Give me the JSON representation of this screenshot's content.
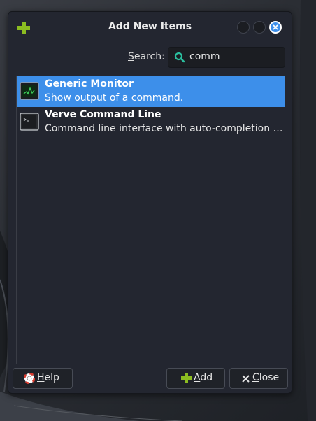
{
  "dialog": {
    "title": "Add New Items",
    "search": {
      "label_first": "S",
      "label_rest": "earch:",
      "value": "comm"
    },
    "items": [
      {
        "name": "Generic Monitor",
        "description": "Show output of a command.",
        "selected": true
      },
      {
        "name": "Verve Command Line",
        "description": "Command line interface with auto-completion and...",
        "selected": false
      }
    ],
    "buttons": {
      "help": {
        "mnemonic": "H",
        "rest": "elp"
      },
      "add": {
        "mnemonic": "A",
        "rest": "dd"
      },
      "close": {
        "mnemonic": "C",
        "rest": "lose"
      }
    }
  },
  "colors": {
    "selection": "#3d8fea",
    "add_icon": "#8bbc21",
    "background": "#232630"
  },
  "icons": [
    "add-icon",
    "window-min-icon",
    "window-max-icon",
    "close-icon",
    "search-icon",
    "monitor-icon",
    "terminal-icon",
    "help-icon",
    "add-plus-icon",
    "close-x-icon"
  ]
}
